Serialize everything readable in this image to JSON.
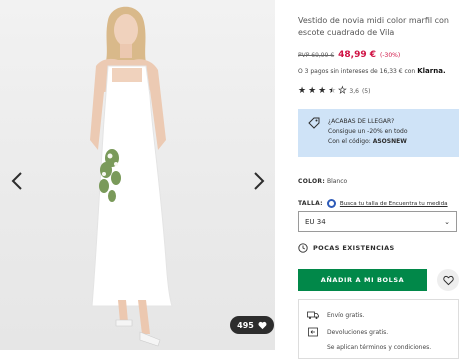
{
  "gallery": {
    "prev_icon": "chevron-left-icon",
    "next_icon": "chevron-right-icon",
    "saved_count": "495",
    "saved_icon": "heart-icon"
  },
  "product": {
    "title": "Vestido de novia midi color marfil con escote cuadrado de Vila",
    "price_old": "PVP 69,99 €",
    "price_new": "48,99 €",
    "discount": "(-30%)",
    "klarna_text": "O 3 pagos sin intereses de 16,33 € con",
    "klarna_brand": "Klarna.",
    "rating_value": "3,6",
    "rating_count": "(5)",
    "rating_stars": 3.5
  },
  "promo": {
    "line1": "¿ACABAS DE LLEGAR?",
    "line2": "Consigue un -20% en todo",
    "line3_prefix": "Con el código:",
    "code": "ASOSNEW"
  },
  "color": {
    "label": "COLOR:",
    "value": "Blanco"
  },
  "size": {
    "label": "TALLA:",
    "link": "Busca tu talla de Encuentra tu medida",
    "selected": "EU 34"
  },
  "stock": {
    "label": "POCAS EXISTENCIAS"
  },
  "actions": {
    "add_to_bag": "AÑADIR A MI BOLSA"
  },
  "delivery": {
    "line1": "Envío gratis.",
    "line2": "Devoluciones gratis.",
    "line3": "Se aplican términos y condiciones."
  },
  "colors": {
    "accent_green": "#018849",
    "sale_red": "#d01345",
    "promo_bg": "#cfe3f7"
  }
}
